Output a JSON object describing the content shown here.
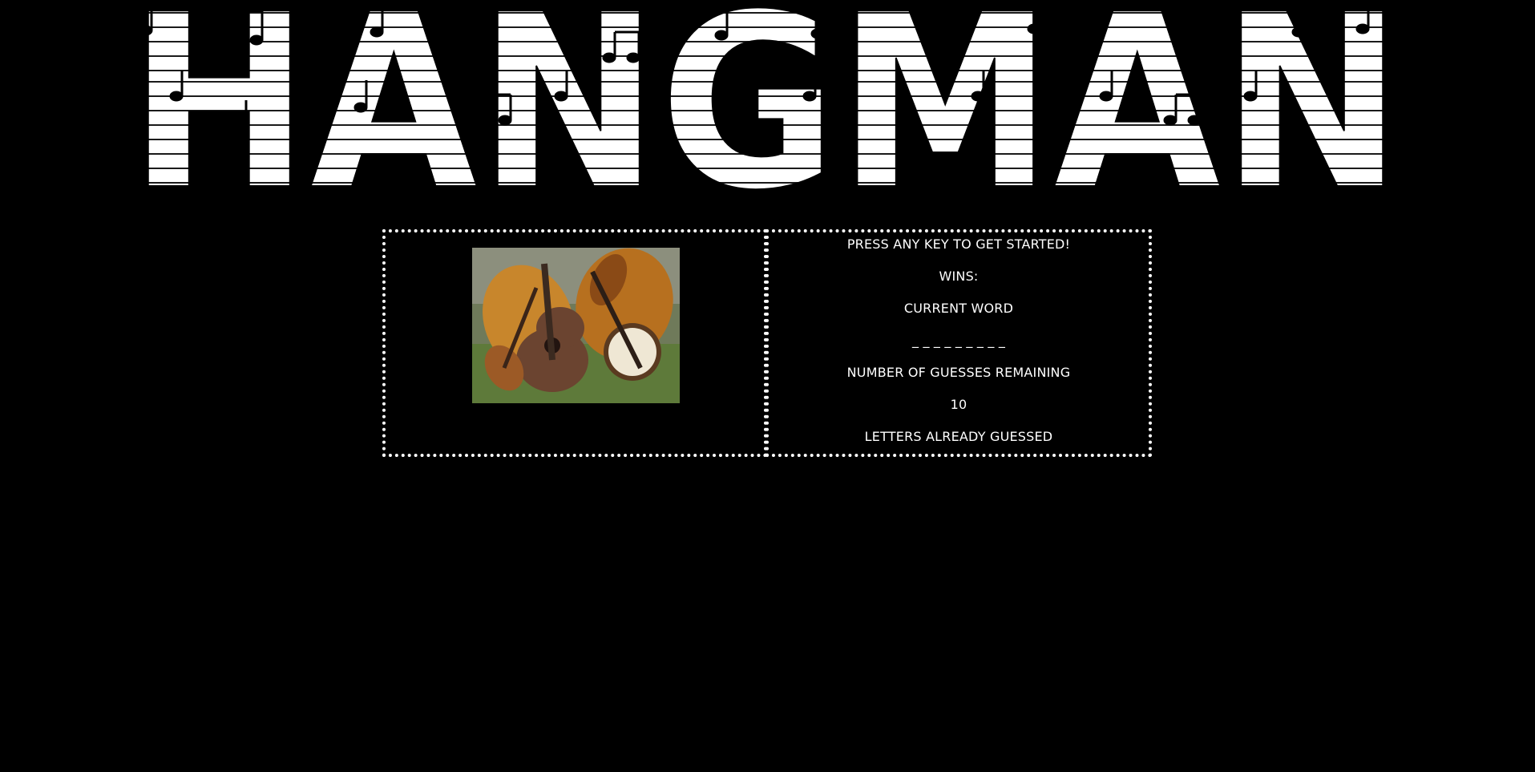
{
  "banner": {
    "title_letters": [
      "H",
      "A",
      "N",
      "G",
      "M",
      "A",
      "N"
    ],
    "title_color": "#ffffff",
    "background": "#000000"
  },
  "image_panel": {
    "image_subject": "acoustic string instruments (guitar, violin, cello, banjo) on grass"
  },
  "info_panel": {
    "start_prompt": "PRESS ANY KEY TO GET STARTED!",
    "wins_label": "WINS:",
    "current_word_label": "CURRENT WORD",
    "current_word_value": "_ _ _ _ _ _ _ _ _",
    "guesses_remaining_label": "NUMBER OF GUESSES REMAINING",
    "guesses_remaining_value": "10",
    "letters_guessed_label": "LETTERS ALREADY GUESSED"
  },
  "colors": {
    "page_background": "#000000",
    "text": "#ffffff",
    "border": "#ffffff"
  }
}
